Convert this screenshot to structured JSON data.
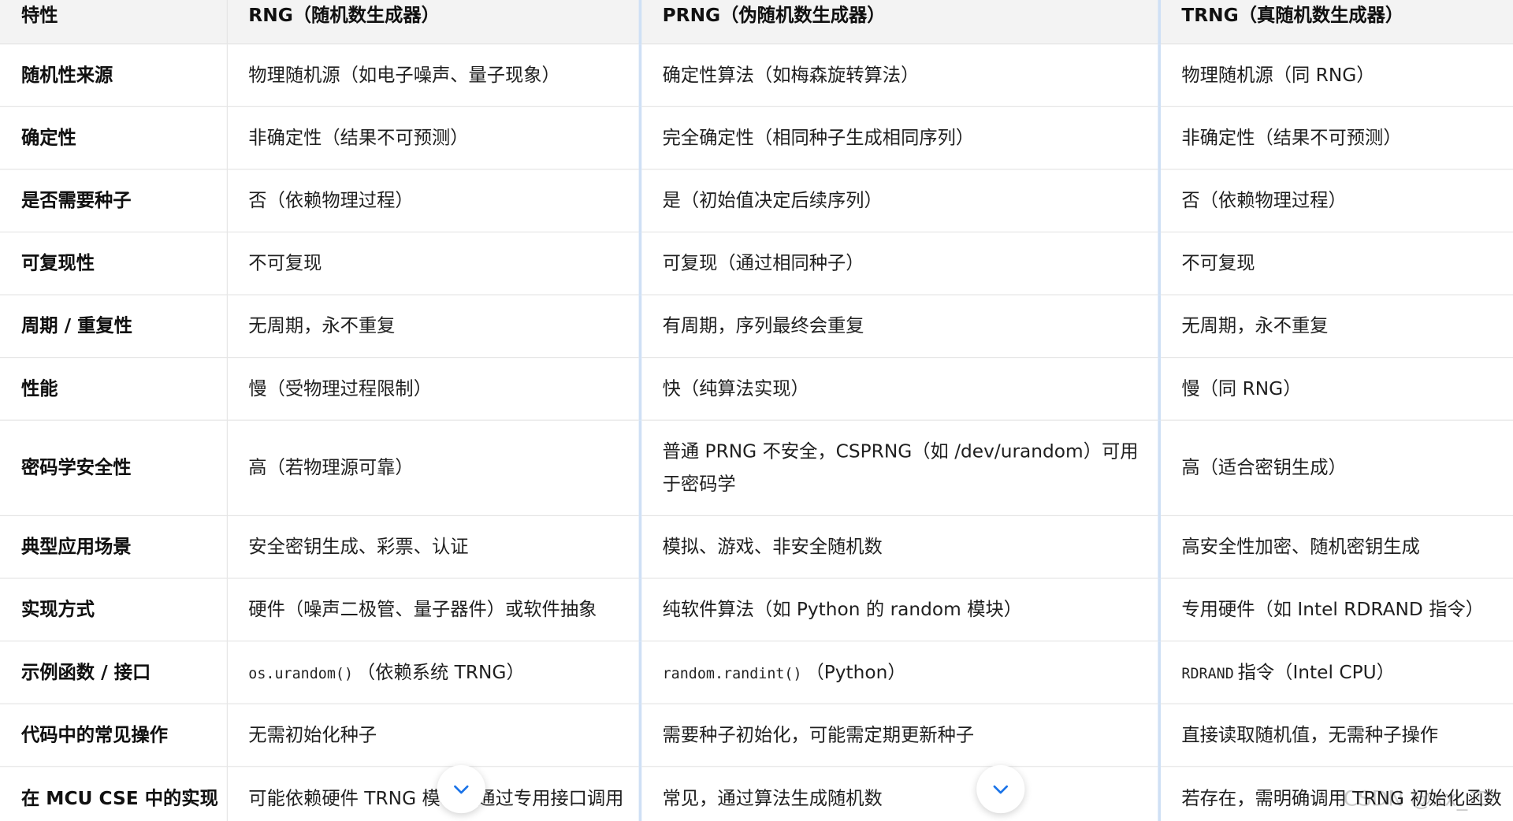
{
  "table": {
    "headers": [
      "特性",
      "RNG（随机数生成器）",
      "PRNG（伪随机数生成器）",
      "TRNG（真随机数生成器）"
    ],
    "rows": [
      {
        "feature": "随机性来源",
        "rng": "物理随机源（如电子噪声、量子现象）",
        "prng": "确定性算法（如梅森旋转算法）",
        "trng": "物理随机源（同 RNG）"
      },
      {
        "feature": "确定性",
        "rng": "非确定性（结果不可预测）",
        "prng": "完全确定性（相同种子生成相同序列）",
        "trng": "非确定性（结果不可预测）"
      },
      {
        "feature": "是否需要种子",
        "rng": "否（依赖物理过程）",
        "prng": "是（初始值决定后续序列）",
        "trng": "否（依赖物理过程）"
      },
      {
        "feature": "可复现性",
        "rng": "不可复现",
        "prng": "可复现（通过相同种子）",
        "trng": "不可复现"
      },
      {
        "feature": "周期 / 重复性",
        "rng": "无周期，永不重复",
        "prng": "有周期，序列最终会重复",
        "trng": "无周期，永不重复"
      },
      {
        "feature": "性能",
        "rng": "慢（受物理过程限制）",
        "prng": "快（纯算法实现）",
        "trng": "慢（同 RNG）"
      },
      {
        "feature": "密码学安全性",
        "rng": "高（若物理源可靠）",
        "prng": "普通 PRNG 不安全，CSPRNG（如 /dev/urandom）可用于密码学",
        "trng": "高（适合密钥生成）"
      },
      {
        "feature": "典型应用场景",
        "rng": "安全密钥生成、彩票、认证",
        "prng": "模拟、游戏、非安全随机数",
        "trng": "高安全性加密、随机密钥生成"
      },
      {
        "feature": "实现方式",
        "rng": "硬件（噪声二极管、量子器件）或软件抽象",
        "prng": "纯软件算法（如 Python 的 random 模块）",
        "trng": "专用硬件（如 Intel RDRAND 指令）"
      },
      {
        "feature": "示例函数 / 接口",
        "rng_code": "os.urandom()",
        "rng": "（依赖系统 TRNG）",
        "prng_code": "random.randint()",
        "prng": "（Python）",
        "trng_code": "RDRAND",
        "trng": "指令（Intel CPU）"
      },
      {
        "feature": "代码中的常见操作",
        "rng": "无需初始化种子",
        "prng": "需要种子初始化，可能需定期更新种子",
        "trng": "直接读取随机值，无需种子操作"
      },
      {
        "feature": "在 MCU CSE 中的实现",
        "rng": "可能依赖硬件 TRNG 模块，通过专用接口调用",
        "prng": "常见，通过算法生成随机数",
        "trng": "若存在，需明确调用 TRNG 初始化函数"
      }
    ]
  },
  "scroll_buttons": [
    {
      "icon": "chevron-down-icon"
    },
    {
      "icon": "chevron-down-icon"
    }
  ],
  "watermark": "CSDN @xx_二"
}
